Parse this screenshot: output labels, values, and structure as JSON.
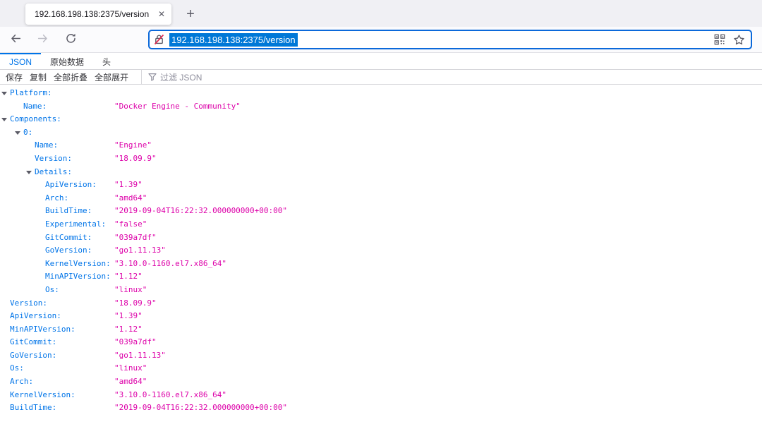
{
  "browser": {
    "tab_title": "192.168.198.138:2375/version",
    "url": "192.168.198.138:2375/version"
  },
  "icons": {
    "close_tab": "✕",
    "new_tab": "+",
    "back": "arrow-left",
    "forward": "arrow-right",
    "reload": "refresh",
    "insecure": "lock-slash",
    "qr": "qr-code",
    "bookmark": "star",
    "filter": "funnel",
    "twisty": "triangle-down"
  },
  "viewer": {
    "tabs": [
      {
        "label": "JSON",
        "active": true
      },
      {
        "label": "原始数据",
        "active": false
      },
      {
        "label": "头",
        "active": false
      }
    ],
    "toolbar": {
      "buttons": [
        "保存",
        "复制",
        "全部折叠",
        "全部展开"
      ],
      "filter_placeholder": "过滤 JSON"
    }
  },
  "json_tree": {
    "rows": [
      {
        "level": 0,
        "twisty": true,
        "key": "Platform:",
        "value": ""
      },
      {
        "level": 1,
        "twisty": false,
        "key": "Name:",
        "value": "\"Docker Engine - Community\""
      },
      {
        "level": 0,
        "twisty": true,
        "key": "Components:",
        "value": ""
      },
      {
        "level": 1,
        "twisty": true,
        "key": "0:",
        "value": ""
      },
      {
        "level": 2,
        "twisty": false,
        "key": "Name:",
        "value": "\"Engine\""
      },
      {
        "level": 2,
        "twisty": false,
        "key": "Version:",
        "value": "\"18.09.9\""
      },
      {
        "level": 2,
        "twisty": true,
        "key": "Details:",
        "value": ""
      },
      {
        "level": 3,
        "twisty": false,
        "key": "ApiVersion:",
        "value": "\"1.39\""
      },
      {
        "level": 3,
        "twisty": false,
        "key": "Arch:",
        "value": "\"amd64\""
      },
      {
        "level": 3,
        "twisty": false,
        "key": "BuildTime:",
        "value": "\"2019-09-04T16:22:32.000000000+00:00\""
      },
      {
        "level": 3,
        "twisty": false,
        "key": "Experimental:",
        "value": "\"false\""
      },
      {
        "level": 3,
        "twisty": false,
        "key": "GitCommit:",
        "value": "\"039a7df\""
      },
      {
        "level": 3,
        "twisty": false,
        "key": "GoVersion:",
        "value": "\"go1.11.13\""
      },
      {
        "level": 3,
        "twisty": false,
        "key": "KernelVersion:",
        "value": "\"3.10.0-1160.el7.x86_64\""
      },
      {
        "level": 3,
        "twisty": false,
        "key": "MinAPIVersion:",
        "value": "\"1.12\""
      },
      {
        "level": 3,
        "twisty": false,
        "key": "Os:",
        "value": "\"linux\""
      },
      {
        "level": 0,
        "twisty": false,
        "key": "Version:",
        "value": "\"18.09.9\""
      },
      {
        "level": 0,
        "twisty": false,
        "key": "ApiVersion:",
        "value": "\"1.39\""
      },
      {
        "level": 0,
        "twisty": false,
        "key": "MinAPIVersion:",
        "value": "\"1.12\""
      },
      {
        "level": 0,
        "twisty": false,
        "key": "GitCommit:",
        "value": "\"039a7df\""
      },
      {
        "level": 0,
        "twisty": false,
        "key": "GoVersion:",
        "value": "\"go1.11.13\""
      },
      {
        "level": 0,
        "twisty": false,
        "key": "Os:",
        "value": "\"linux\""
      },
      {
        "level": 0,
        "twisty": false,
        "key": "Arch:",
        "value": "\"amd64\""
      },
      {
        "level": 0,
        "twisty": false,
        "key": "KernelVersion:",
        "value": "\"3.10.0-1160.el7.x86_64\""
      },
      {
        "level": 0,
        "twisty": false,
        "key": "BuildTime:",
        "value": "\"2019-09-04T16:22:32.000000000+00:00\""
      }
    ]
  },
  "colors": {
    "key_blue": "#0074e8",
    "string_magenta": "#dd00a9",
    "selection_blue": "#0078d7",
    "insecure_red": "#e22850",
    "accent_tab_blue": "#0074e8"
  }
}
